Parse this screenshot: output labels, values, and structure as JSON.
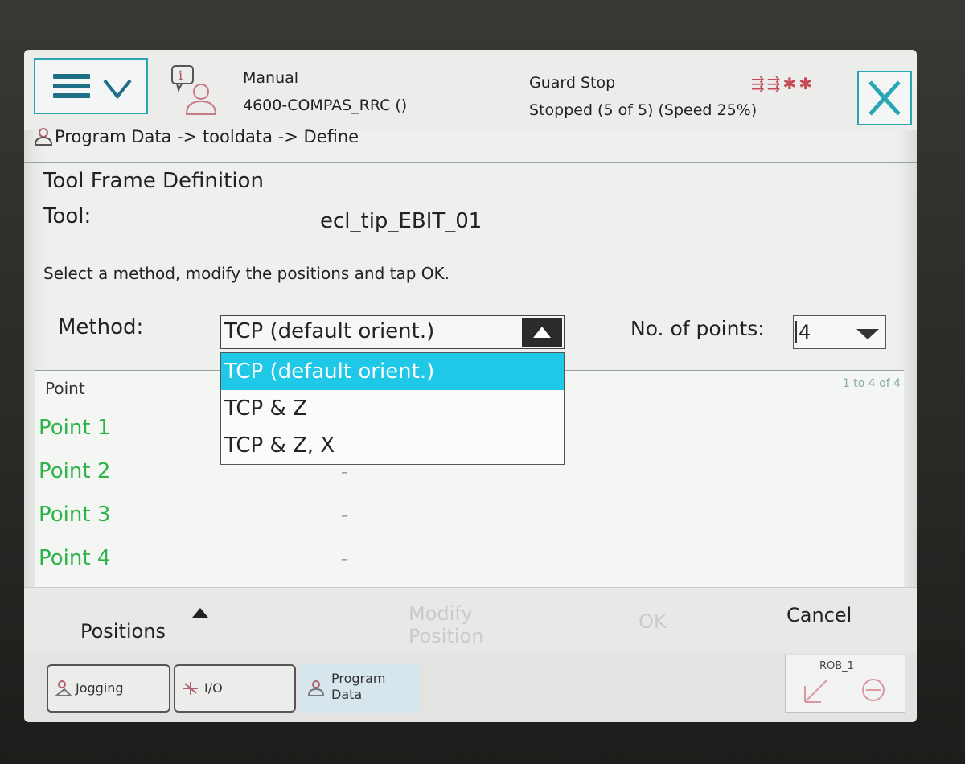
{
  "header": {
    "mode": "Manual",
    "controller": "4600-COMPAS_RRC ()",
    "state": "Guard Stop",
    "run_status": "Stopped (5 of 5) (Speed 25%)",
    "status_icons": "⇶⇶✱✱"
  },
  "breadcrumb": "Program Data -> tooldata -> Define",
  "page": {
    "title": "Tool Frame Definition",
    "tool_label": "Tool:",
    "tool_value": "ecl_tip_EBIT_01",
    "instruction": "Select a method, modify the positions and tap OK."
  },
  "method": {
    "label": "Method:",
    "selected": "TCP (default orient.)",
    "options": [
      "TCP (default orient.)",
      "TCP & Z",
      "TCP & Z, X"
    ]
  },
  "points_count": {
    "label": "No. of points:",
    "value": "4"
  },
  "grid": {
    "header": "Point",
    "range": "1 to 4 of 4",
    "rows": [
      "Point  1",
      "Point  2",
      "Point  3",
      "Point  4"
    ],
    "dash": "–"
  },
  "commands": {
    "positions": "Positions",
    "modify_position": "Modify Position",
    "ok": "OK",
    "cancel": "Cancel"
  },
  "taskbar": {
    "jogging": "Jogging",
    "io": "I/O",
    "program_data": "Program Data",
    "rob": "ROB_1"
  },
  "colors": {
    "accent": "#2aa6b3",
    "selection": "#1ec8e6",
    "point_text": "#2fb24a"
  }
}
